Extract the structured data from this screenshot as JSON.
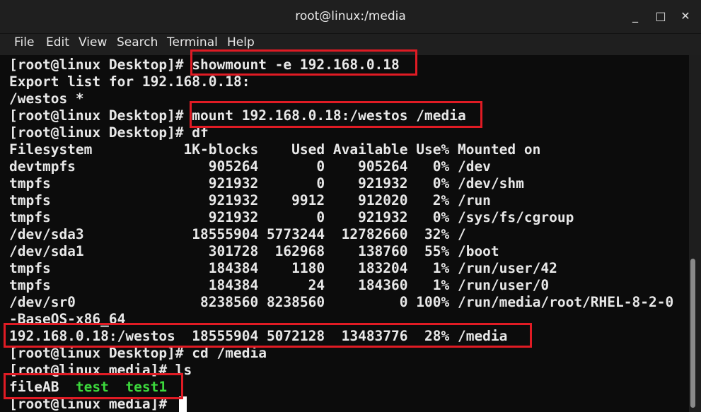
{
  "window": {
    "title": "root@linux:/media",
    "controls": {
      "minimize": "_",
      "maximize": "□",
      "close": "✕"
    }
  },
  "menu": [
    "File",
    "Edit",
    "View",
    "Search",
    "Terminal",
    "Help"
  ],
  "terminal": {
    "lines": [
      {
        "text": "[root@linux Desktop]# showmount -e 192.168.0.18"
      },
      {
        "text": "Export list for 192.168.0.18:"
      },
      {
        "text": "/westos *"
      },
      {
        "text": "[root@linux Desktop]# mount 192.168.0.18:/westos /media"
      },
      {
        "text": "[root@linux Desktop]# df"
      },
      {
        "text": "Filesystem           1K-blocks    Used Available Use% Mounted on"
      },
      {
        "text": "devtmpfs                905264       0    905264   0% /dev"
      },
      {
        "text": "tmpfs                   921932       0    921932   0% /dev/shm"
      },
      {
        "text": "tmpfs                   921932    9912    912020   2% /run"
      },
      {
        "text": "tmpfs                   921932       0    921932   0% /sys/fs/cgroup"
      },
      {
        "text": "/dev/sda3             18555904 5773244  12782660  32% /"
      },
      {
        "text": "/dev/sda1               301728  162968    138760  55% /boot"
      },
      {
        "text": "tmpfs                   184384    1180    183204   1% /run/user/42"
      },
      {
        "text": "tmpfs                   184384      24    184360   1% /run/user/0"
      },
      {
        "text": "/dev/sr0               8238560 8238560         0 100% /run/media/root/RHEL-8-2-0"
      },
      {
        "text": "-BaseOS-x86_64"
      },
      {
        "text": "192.168.0.18:/westos  18555904 5072128  13483776  28% /media"
      },
      {
        "text": "[root@linux Desktop]# cd /media"
      },
      {
        "text": "[root@linux media]# ls"
      }
    ],
    "ls_output": {
      "file": "fileAB",
      "dir1": "test",
      "dir2": "test1"
    },
    "prompt": "[root@linux media]# "
  },
  "colors": {
    "highlight_box": "#e01b24",
    "directory_green": "#3cd83c",
    "terminal_bg": "#0c0c0c",
    "text": "#e8e8e8"
  }
}
